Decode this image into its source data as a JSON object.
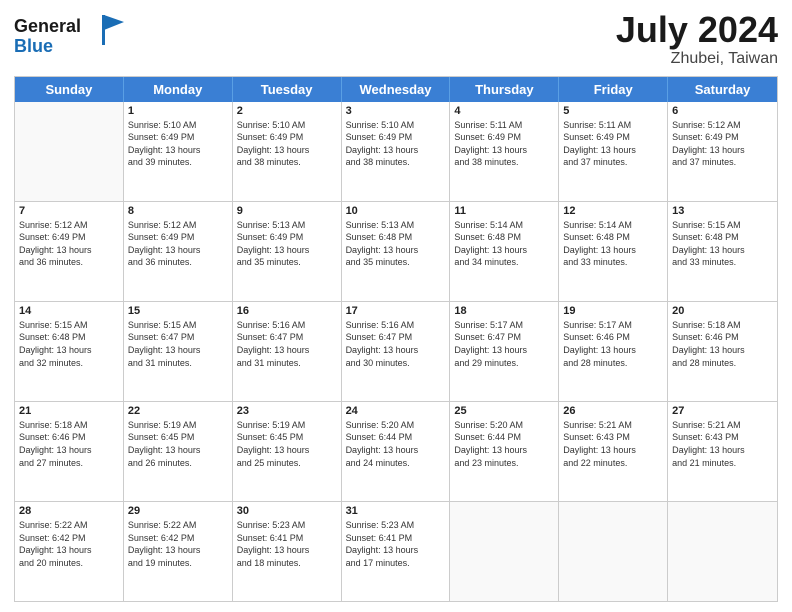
{
  "logo": {
    "line1": "General",
    "line2": "Blue"
  },
  "header": {
    "month": "July 2024",
    "location": "Zhubei, Taiwan"
  },
  "days": [
    "Sunday",
    "Monday",
    "Tuesday",
    "Wednesday",
    "Thursday",
    "Friday",
    "Saturday"
  ],
  "weeks": [
    [
      {
        "day": "",
        "sunrise": "",
        "sunset": "",
        "daylight": ""
      },
      {
        "day": "1",
        "sunrise": "5:10 AM",
        "sunset": "6:49 PM",
        "daylight": "13 hours and 39 minutes."
      },
      {
        "day": "2",
        "sunrise": "5:10 AM",
        "sunset": "6:49 PM",
        "daylight": "13 hours and 38 minutes."
      },
      {
        "day": "3",
        "sunrise": "5:10 AM",
        "sunset": "6:49 PM",
        "daylight": "13 hours and 38 minutes."
      },
      {
        "day": "4",
        "sunrise": "5:11 AM",
        "sunset": "6:49 PM",
        "daylight": "13 hours and 38 minutes."
      },
      {
        "day": "5",
        "sunrise": "5:11 AM",
        "sunset": "6:49 PM",
        "daylight": "13 hours and 37 minutes."
      },
      {
        "day": "6",
        "sunrise": "5:12 AM",
        "sunset": "6:49 PM",
        "daylight": "13 hours and 37 minutes."
      }
    ],
    [
      {
        "day": "7",
        "sunrise": "5:12 AM",
        "sunset": "6:49 PM",
        "daylight": "13 hours and 36 minutes."
      },
      {
        "day": "8",
        "sunrise": "5:12 AM",
        "sunset": "6:49 PM",
        "daylight": "13 hours and 36 minutes."
      },
      {
        "day": "9",
        "sunrise": "5:13 AM",
        "sunset": "6:49 PM",
        "daylight": "13 hours and 35 minutes."
      },
      {
        "day": "10",
        "sunrise": "5:13 AM",
        "sunset": "6:48 PM",
        "daylight": "13 hours and 35 minutes."
      },
      {
        "day": "11",
        "sunrise": "5:14 AM",
        "sunset": "6:48 PM",
        "daylight": "13 hours and 34 minutes."
      },
      {
        "day": "12",
        "sunrise": "5:14 AM",
        "sunset": "6:48 PM",
        "daylight": "13 hours and 33 minutes."
      },
      {
        "day": "13",
        "sunrise": "5:15 AM",
        "sunset": "6:48 PM",
        "daylight": "13 hours and 33 minutes."
      }
    ],
    [
      {
        "day": "14",
        "sunrise": "5:15 AM",
        "sunset": "6:48 PM",
        "daylight": "13 hours and 32 minutes."
      },
      {
        "day": "15",
        "sunrise": "5:15 AM",
        "sunset": "6:47 PM",
        "daylight": "13 hours and 31 minutes."
      },
      {
        "day": "16",
        "sunrise": "5:16 AM",
        "sunset": "6:47 PM",
        "daylight": "13 hours and 31 minutes."
      },
      {
        "day": "17",
        "sunrise": "5:16 AM",
        "sunset": "6:47 PM",
        "daylight": "13 hours and 30 minutes."
      },
      {
        "day": "18",
        "sunrise": "5:17 AM",
        "sunset": "6:47 PM",
        "daylight": "13 hours and 29 minutes."
      },
      {
        "day": "19",
        "sunrise": "5:17 AM",
        "sunset": "6:46 PM",
        "daylight": "13 hours and 28 minutes."
      },
      {
        "day": "20",
        "sunrise": "5:18 AM",
        "sunset": "6:46 PM",
        "daylight": "13 hours and 28 minutes."
      }
    ],
    [
      {
        "day": "21",
        "sunrise": "5:18 AM",
        "sunset": "6:46 PM",
        "daylight": "13 hours and 27 minutes."
      },
      {
        "day": "22",
        "sunrise": "5:19 AM",
        "sunset": "6:45 PM",
        "daylight": "13 hours and 26 minutes."
      },
      {
        "day": "23",
        "sunrise": "5:19 AM",
        "sunset": "6:45 PM",
        "daylight": "13 hours and 25 minutes."
      },
      {
        "day": "24",
        "sunrise": "5:20 AM",
        "sunset": "6:44 PM",
        "daylight": "13 hours and 24 minutes."
      },
      {
        "day": "25",
        "sunrise": "5:20 AM",
        "sunset": "6:44 PM",
        "daylight": "13 hours and 23 minutes."
      },
      {
        "day": "26",
        "sunrise": "5:21 AM",
        "sunset": "6:43 PM",
        "daylight": "13 hours and 22 minutes."
      },
      {
        "day": "27",
        "sunrise": "5:21 AM",
        "sunset": "6:43 PM",
        "daylight": "13 hours and 21 minutes."
      }
    ],
    [
      {
        "day": "28",
        "sunrise": "5:22 AM",
        "sunset": "6:42 PM",
        "daylight": "13 hours and 20 minutes."
      },
      {
        "day": "29",
        "sunrise": "5:22 AM",
        "sunset": "6:42 PM",
        "daylight": "13 hours and 19 minutes."
      },
      {
        "day": "30",
        "sunrise": "5:23 AM",
        "sunset": "6:41 PM",
        "daylight": "13 hours and 18 minutes."
      },
      {
        "day": "31",
        "sunrise": "5:23 AM",
        "sunset": "6:41 PM",
        "daylight": "13 hours and 17 minutes."
      },
      {
        "day": "",
        "sunrise": "",
        "sunset": "",
        "daylight": ""
      },
      {
        "day": "",
        "sunrise": "",
        "sunset": "",
        "daylight": ""
      },
      {
        "day": "",
        "sunrise": "",
        "sunset": "",
        "daylight": ""
      }
    ]
  ],
  "labels": {
    "sunrise_prefix": "Sunrise: ",
    "sunset_prefix": "Sunset: ",
    "daylight_prefix": "Daylight: "
  }
}
